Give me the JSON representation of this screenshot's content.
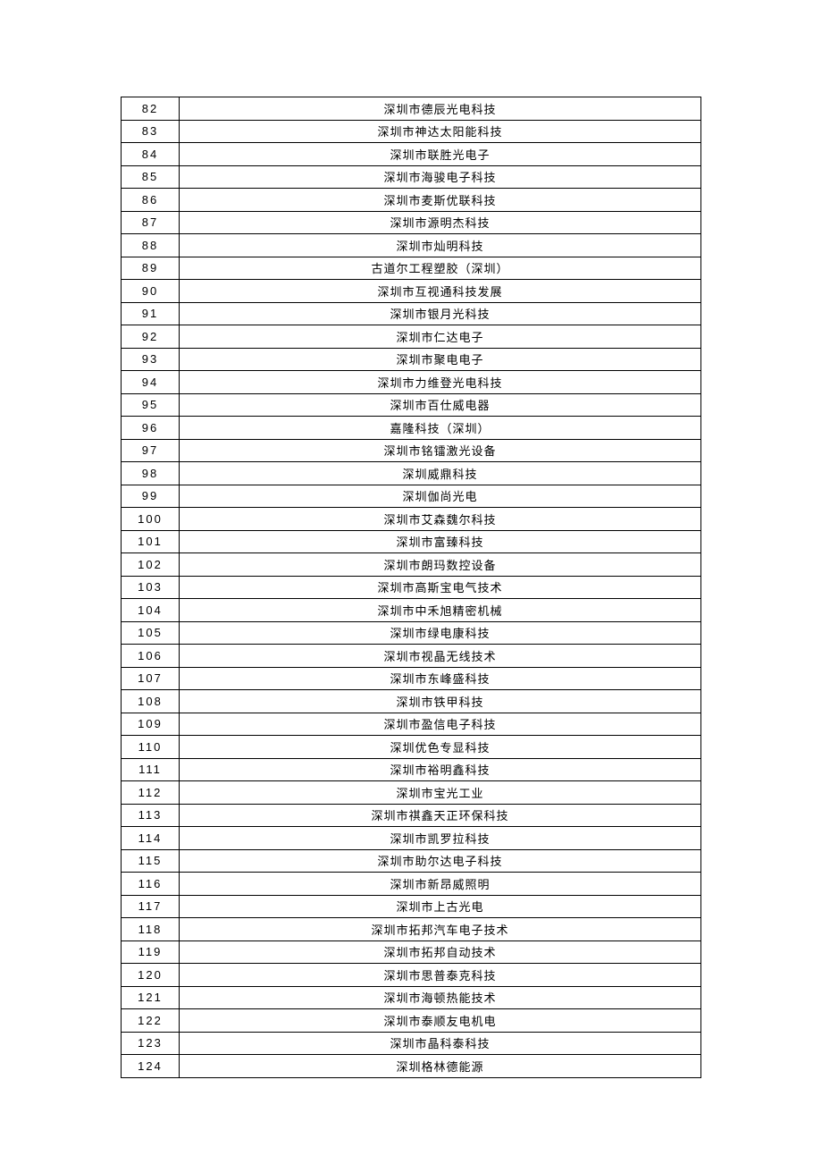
{
  "rows": [
    {
      "num": "82",
      "name": "深圳市德辰光电科技"
    },
    {
      "num": "83",
      "name": "深圳市神达太阳能科技"
    },
    {
      "num": "84",
      "name": "深圳市联胜光电子"
    },
    {
      "num": "85",
      "name": "深圳市海骏电子科技"
    },
    {
      "num": "86",
      "name": "深圳市麦斯优联科技"
    },
    {
      "num": "87",
      "name": "深圳市源明杰科技"
    },
    {
      "num": "88",
      "name": "深圳市灿明科技"
    },
    {
      "num": "89",
      "name": "古道尔工程塑胶（深圳）"
    },
    {
      "num": "90",
      "name": "深圳市互视通科技发展"
    },
    {
      "num": "91",
      "name": "深圳市银月光科技"
    },
    {
      "num": "92",
      "name": "深圳市仁达电子"
    },
    {
      "num": "93",
      "name": "深圳市聚电电子"
    },
    {
      "num": "94",
      "name": "深圳市力维登光电科技"
    },
    {
      "num": "95",
      "name": "深圳市百仕威电器"
    },
    {
      "num": "96",
      "name": "嘉隆科技（深圳）"
    },
    {
      "num": "97",
      "name": "深圳市铭镭激光设备"
    },
    {
      "num": "98",
      "name": "深圳威鼎科技"
    },
    {
      "num": "99",
      "name": "深圳伽尚光电"
    },
    {
      "num": "100",
      "name": "深圳市艾森魏尔科技"
    },
    {
      "num": "101",
      "name": "深圳市富臻科技"
    },
    {
      "num": "102",
      "name": "深圳市朗玛数控设备"
    },
    {
      "num": "103",
      "name": "深圳市高斯宝电气技术"
    },
    {
      "num": "104",
      "name": "深圳市中禾旭精密机械"
    },
    {
      "num": "105",
      "name": "深圳市绿电康科技"
    },
    {
      "num": "106",
      "name": "深圳市视晶无线技术"
    },
    {
      "num": "107",
      "name": "深圳市东峰盛科技"
    },
    {
      "num": "108",
      "name": "深圳市铁甲科技"
    },
    {
      "num": "109",
      "name": "深圳市盈信电子科技"
    },
    {
      "num": "110",
      "name": "深圳优色专显科技"
    },
    {
      "num": "111",
      "name": "深圳市裕明鑫科技"
    },
    {
      "num": "112",
      "name": "深圳市宝光工业"
    },
    {
      "num": "113",
      "name": "深圳市祺鑫天正环保科技"
    },
    {
      "num": "114",
      "name": "深圳市凯罗拉科技"
    },
    {
      "num": "115",
      "name": "深圳市助尔达电子科技"
    },
    {
      "num": "116",
      "name": "深圳市新昂威照明"
    },
    {
      "num": "117",
      "name": "深圳市上古光电"
    },
    {
      "num": "118",
      "name": "深圳市拓邦汽车电子技术"
    },
    {
      "num": "119",
      "name": "深圳市拓邦自动技术"
    },
    {
      "num": "120",
      "name": "深圳市思普泰克科技"
    },
    {
      "num": "121",
      "name": "深圳市海顿热能技术"
    },
    {
      "num": "122",
      "name": "深圳市泰顺友电机电"
    },
    {
      "num": "123",
      "name": "深圳市晶科泰科技"
    },
    {
      "num": "124",
      "name": "深圳格林德能源"
    }
  ]
}
